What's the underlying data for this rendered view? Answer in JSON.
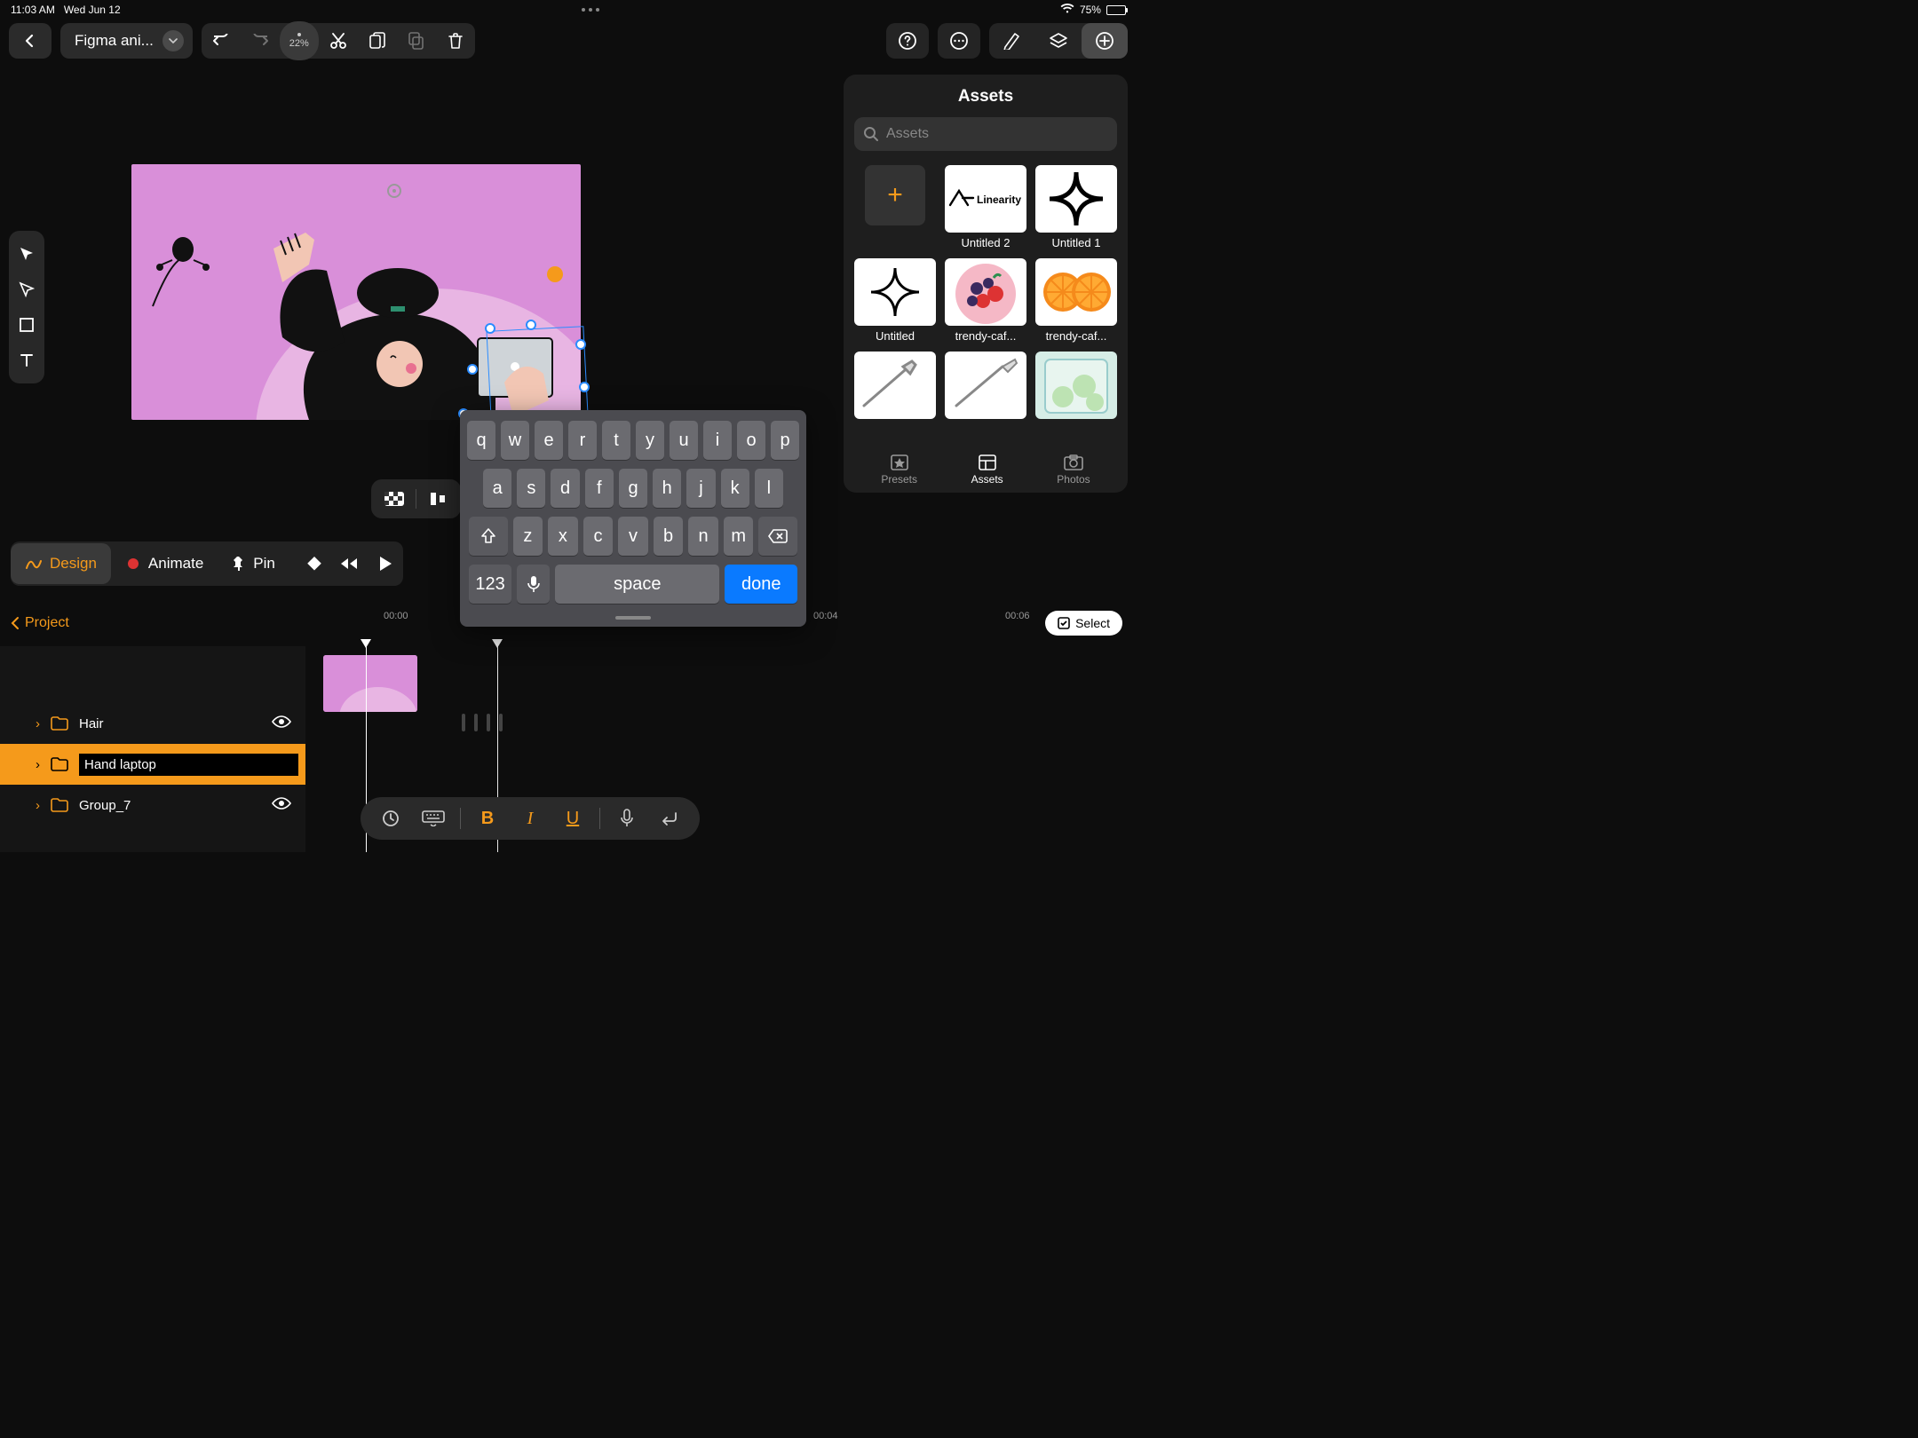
{
  "status": {
    "time": "11:03 AM",
    "date": "Wed Jun 12",
    "battery": "75%"
  },
  "project": {
    "title": "Figma ani..."
  },
  "zoom": "22%",
  "modes": {
    "design": "Design",
    "animate": "Animate",
    "pin": "Pin"
  },
  "timeline": {
    "back_label": "Project",
    "select_label": "Select",
    "ticks": [
      "00:00",
      "00:04",
      "00:06"
    ]
  },
  "layers": [
    {
      "name": "Hair",
      "selected": false,
      "visible": true
    },
    {
      "name": "Hand laptop",
      "selected": true,
      "editing": true,
      "visible": true
    },
    {
      "name": "Group_7",
      "selected": false,
      "visible": true
    }
  ],
  "assets": {
    "title": "Assets",
    "search_placeholder": "Assets",
    "bottom_tabs": {
      "presets": "Presets",
      "assets": "Assets",
      "photos": "Photos"
    },
    "items": [
      {
        "type": "add",
        "label": ""
      },
      {
        "type": "logo",
        "label": "Untitled 2",
        "logo_text": "Linearity"
      },
      {
        "type": "star",
        "label": "Untitled 1"
      },
      {
        "type": "star",
        "label": "Untitled"
      },
      {
        "type": "berries",
        "label": "trendy-caf..."
      },
      {
        "type": "oranges",
        "label": "trendy-caf..."
      },
      {
        "type": "fork",
        "label": ""
      },
      {
        "type": "knife",
        "label": ""
      },
      {
        "type": "cucumber",
        "label": ""
      }
    ]
  },
  "keyboard": {
    "rows": [
      [
        "q",
        "w",
        "e",
        "r",
        "t",
        "y",
        "u",
        "i",
        "o",
        "p"
      ],
      [
        "a",
        "s",
        "d",
        "f",
        "g",
        "h",
        "j",
        "k",
        "l"
      ],
      [
        "⇧",
        "z",
        "x",
        "c",
        "v",
        "b",
        "n",
        "m",
        "⌫"
      ]
    ],
    "numbers": "123",
    "space": "space",
    "done": "done"
  },
  "text_format": {
    "bold": "B",
    "italic": "I",
    "underline": "U"
  }
}
